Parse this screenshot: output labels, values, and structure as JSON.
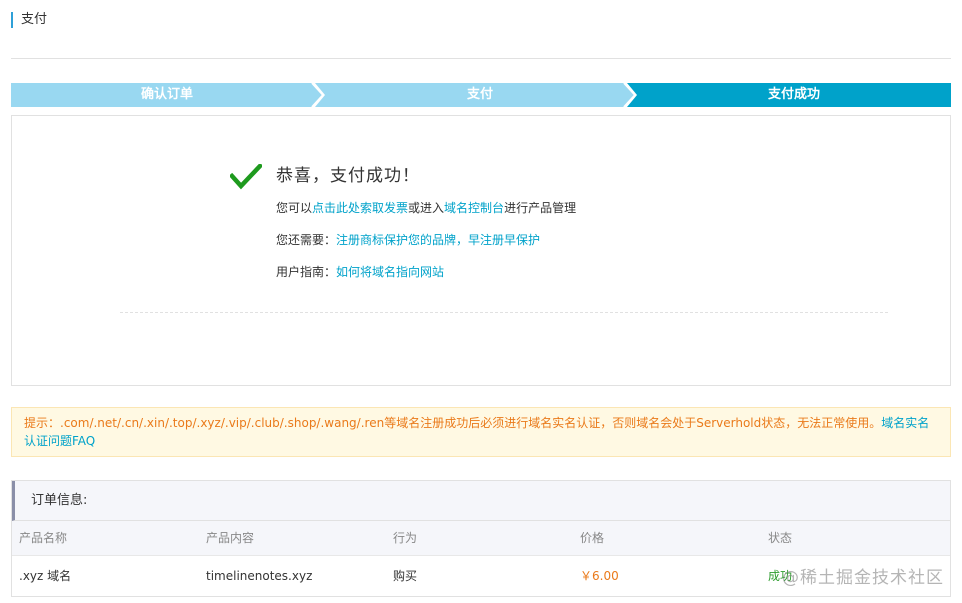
{
  "header": {
    "title": "支付"
  },
  "steps": [
    {
      "label": "确认订单",
      "state": "done"
    },
    {
      "label": "支付",
      "state": "done"
    },
    {
      "label": "支付成功",
      "state": "active"
    }
  ],
  "success": {
    "icon": "check-icon",
    "title": "恭喜，支付成功！",
    "line1": {
      "prefix": "您可以",
      "link1": "点击此处索取发票",
      "middle": "或进入",
      "link2": "域名控制台",
      "suffix": "进行产品管理"
    },
    "line2": {
      "prefix": "您还需要：",
      "link": "注册商标保护您的品牌，早注册早保护"
    },
    "line3": {
      "prefix": "用户指南：",
      "link": "如何将域名指向网站"
    }
  },
  "notice": {
    "text": "提示：.com/.net/.cn/.xin/.top/.xyz/.vip/.club/.shop/.wang/.ren等域名注册成功后必须进行域名实名认证，否则域名会处于Serverhold状态，无法正常使用。",
    "link": "域名实名认证问题FAQ"
  },
  "order": {
    "title": "订单信息:",
    "columns": [
      "产品名称",
      "产品内容",
      "行为",
      "价格",
      "状态"
    ],
    "rows": [
      {
        "name": ".xyz 域名",
        "content": "timelinenotes.xyz",
        "action": "购买",
        "price": "￥6.00",
        "status": "成功"
      }
    ]
  },
  "watermark": "@稀土掘金技术社区",
  "colors": {
    "step_light": "#99d8f1",
    "step_active": "#00a2ca",
    "link": "#00a2ca",
    "warning": "#ea7a1a",
    "success": "#2e9d2e"
  }
}
